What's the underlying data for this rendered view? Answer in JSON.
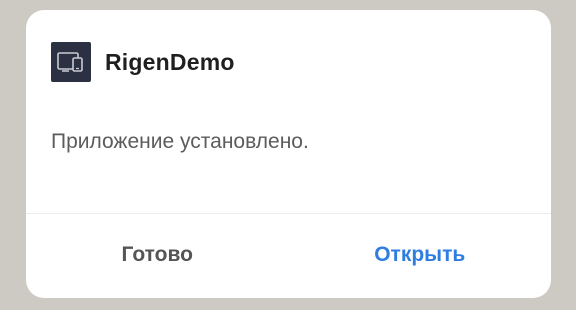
{
  "dialog": {
    "app_name": "RigenDemo",
    "app_icon": "devices-icon",
    "message": "Приложение установлено.",
    "buttons": {
      "done_label": "Готово",
      "open_label": "Открыть"
    }
  },
  "colors": {
    "backdrop": "#cdc9c3",
    "dialog_bg": "#ffffff",
    "icon_bg": "#2b3142",
    "primary_action": "#2f7de1",
    "secondary_action": "#555555",
    "message_text": "#5c5c5c"
  }
}
